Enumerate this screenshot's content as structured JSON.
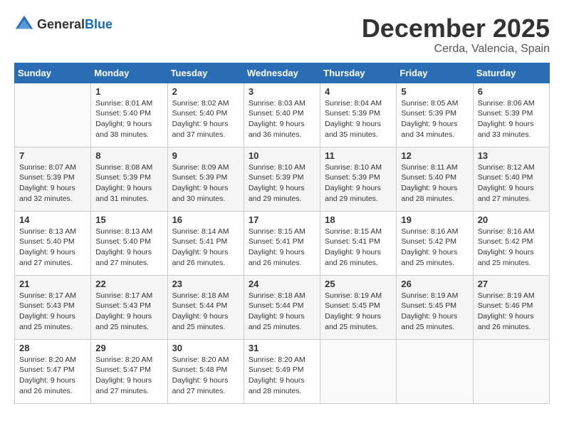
{
  "header": {
    "logo_general": "General",
    "logo_blue": "Blue",
    "month_title": "December 2025",
    "location": "Cerda, Valencia, Spain"
  },
  "weekdays": [
    "Sunday",
    "Monday",
    "Tuesday",
    "Wednesday",
    "Thursday",
    "Friday",
    "Saturday"
  ],
  "weeks": [
    [
      {
        "day": "",
        "sunrise": "",
        "sunset": "",
        "daylight": ""
      },
      {
        "day": "1",
        "sunrise": "Sunrise: 8:01 AM",
        "sunset": "Sunset: 5:40 PM",
        "daylight": "Daylight: 9 hours and 38 minutes."
      },
      {
        "day": "2",
        "sunrise": "Sunrise: 8:02 AM",
        "sunset": "Sunset: 5:40 PM",
        "daylight": "Daylight: 9 hours and 37 minutes."
      },
      {
        "day": "3",
        "sunrise": "Sunrise: 8:03 AM",
        "sunset": "Sunset: 5:40 PM",
        "daylight": "Daylight: 9 hours and 36 minutes."
      },
      {
        "day": "4",
        "sunrise": "Sunrise: 8:04 AM",
        "sunset": "Sunset: 5:39 PM",
        "daylight": "Daylight: 9 hours and 35 minutes."
      },
      {
        "day": "5",
        "sunrise": "Sunrise: 8:05 AM",
        "sunset": "Sunset: 5:39 PM",
        "daylight": "Daylight: 9 hours and 34 minutes."
      },
      {
        "day": "6",
        "sunrise": "Sunrise: 8:06 AM",
        "sunset": "Sunset: 5:39 PM",
        "daylight": "Daylight: 9 hours and 33 minutes."
      }
    ],
    [
      {
        "day": "7",
        "sunrise": "Sunrise: 8:07 AM",
        "sunset": "Sunset: 5:39 PM",
        "daylight": "Daylight: 9 hours and 32 minutes."
      },
      {
        "day": "8",
        "sunrise": "Sunrise: 8:08 AM",
        "sunset": "Sunset: 5:39 PM",
        "daylight": "Daylight: 9 hours and 31 minutes."
      },
      {
        "day": "9",
        "sunrise": "Sunrise: 8:09 AM",
        "sunset": "Sunset: 5:39 PM",
        "daylight": "Daylight: 9 hours and 30 minutes."
      },
      {
        "day": "10",
        "sunrise": "Sunrise: 8:10 AM",
        "sunset": "Sunset: 5:39 PM",
        "daylight": "Daylight: 9 hours and 29 minutes."
      },
      {
        "day": "11",
        "sunrise": "Sunrise: 8:10 AM",
        "sunset": "Sunset: 5:39 PM",
        "daylight": "Daylight: 9 hours and 29 minutes."
      },
      {
        "day": "12",
        "sunrise": "Sunrise: 8:11 AM",
        "sunset": "Sunset: 5:40 PM",
        "daylight": "Daylight: 9 hours and 28 minutes."
      },
      {
        "day": "13",
        "sunrise": "Sunrise: 8:12 AM",
        "sunset": "Sunset: 5:40 PM",
        "daylight": "Daylight: 9 hours and 27 minutes."
      }
    ],
    [
      {
        "day": "14",
        "sunrise": "Sunrise: 8:13 AM",
        "sunset": "Sunset: 5:40 PM",
        "daylight": "Daylight: 9 hours and 27 minutes."
      },
      {
        "day": "15",
        "sunrise": "Sunrise: 8:13 AM",
        "sunset": "Sunset: 5:40 PM",
        "daylight": "Daylight: 9 hours and 27 minutes."
      },
      {
        "day": "16",
        "sunrise": "Sunrise: 8:14 AM",
        "sunset": "Sunset: 5:41 PM",
        "daylight": "Daylight: 9 hours and 26 minutes."
      },
      {
        "day": "17",
        "sunrise": "Sunrise: 8:15 AM",
        "sunset": "Sunset: 5:41 PM",
        "daylight": "Daylight: 9 hours and 26 minutes."
      },
      {
        "day": "18",
        "sunrise": "Sunrise: 8:15 AM",
        "sunset": "Sunset: 5:41 PM",
        "daylight": "Daylight: 9 hours and 26 minutes."
      },
      {
        "day": "19",
        "sunrise": "Sunrise: 8:16 AM",
        "sunset": "Sunset: 5:42 PM",
        "daylight": "Daylight: 9 hours and 25 minutes."
      },
      {
        "day": "20",
        "sunrise": "Sunrise: 8:16 AM",
        "sunset": "Sunset: 5:42 PM",
        "daylight": "Daylight: 9 hours and 25 minutes."
      }
    ],
    [
      {
        "day": "21",
        "sunrise": "Sunrise: 8:17 AM",
        "sunset": "Sunset: 5:43 PM",
        "daylight": "Daylight: 9 hours and 25 minutes."
      },
      {
        "day": "22",
        "sunrise": "Sunrise: 8:17 AM",
        "sunset": "Sunset: 5:43 PM",
        "daylight": "Daylight: 9 hours and 25 minutes."
      },
      {
        "day": "23",
        "sunrise": "Sunrise: 8:18 AM",
        "sunset": "Sunset: 5:44 PM",
        "daylight": "Daylight: 9 hours and 25 minutes."
      },
      {
        "day": "24",
        "sunrise": "Sunrise: 8:18 AM",
        "sunset": "Sunset: 5:44 PM",
        "daylight": "Daylight: 9 hours and 25 minutes."
      },
      {
        "day": "25",
        "sunrise": "Sunrise: 8:19 AM",
        "sunset": "Sunset: 5:45 PM",
        "daylight": "Daylight: 9 hours and 25 minutes."
      },
      {
        "day": "26",
        "sunrise": "Sunrise: 8:19 AM",
        "sunset": "Sunset: 5:45 PM",
        "daylight": "Daylight: 9 hours and 25 minutes."
      },
      {
        "day": "27",
        "sunrise": "Sunrise: 8:19 AM",
        "sunset": "Sunset: 5:46 PM",
        "daylight": "Daylight: 9 hours and 26 minutes."
      }
    ],
    [
      {
        "day": "28",
        "sunrise": "Sunrise: 8:20 AM",
        "sunset": "Sunset: 5:47 PM",
        "daylight": "Daylight: 9 hours and 26 minutes."
      },
      {
        "day": "29",
        "sunrise": "Sunrise: 8:20 AM",
        "sunset": "Sunset: 5:47 PM",
        "daylight": "Daylight: 9 hours and 27 minutes."
      },
      {
        "day": "30",
        "sunrise": "Sunrise: 8:20 AM",
        "sunset": "Sunset: 5:48 PM",
        "daylight": "Daylight: 9 hours and 27 minutes."
      },
      {
        "day": "31",
        "sunrise": "Sunrise: 8:20 AM",
        "sunset": "Sunset: 5:49 PM",
        "daylight": "Daylight: 9 hours and 28 minutes."
      },
      {
        "day": "",
        "sunrise": "",
        "sunset": "",
        "daylight": ""
      },
      {
        "day": "",
        "sunrise": "",
        "sunset": "",
        "daylight": ""
      },
      {
        "day": "",
        "sunrise": "",
        "sunset": "",
        "daylight": ""
      }
    ]
  ]
}
